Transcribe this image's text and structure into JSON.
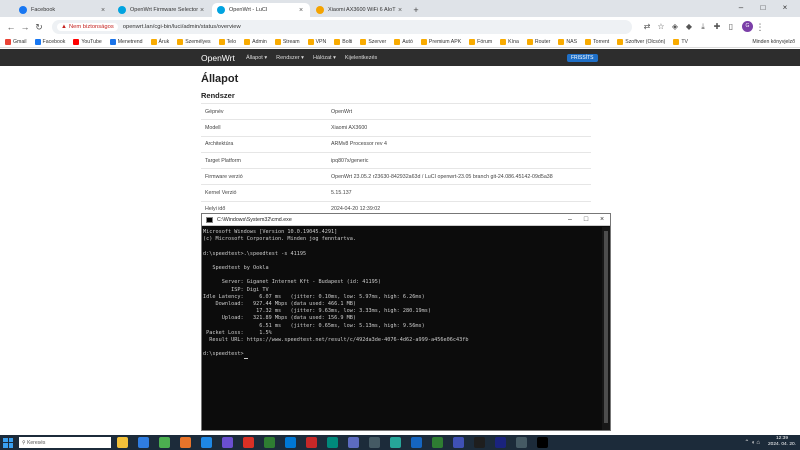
{
  "browser": {
    "tabs": [
      {
        "label": "Facebook",
        "color": "#1877f2",
        "active": false
      },
      {
        "label": "OpenWrt Firmware Selector",
        "color": "#00a3e0",
        "active": false
      },
      {
        "label": "OpenWrt - LuCI",
        "color": "#00a3e0",
        "active": true
      },
      {
        "label": "Xiaomi AX3600 WiFi 6 AIoT R",
        "color": "#f4a300",
        "active": false
      }
    ],
    "address": {
      "security_label": "Nem biztonságos",
      "url": "openwrt.lan/cgi-bin/luci/admin/status/overview"
    },
    "avatar_initial": "G",
    "bookmarks": [
      {
        "label": "Gmail",
        "color": "#ea4335"
      },
      {
        "label": "Facebook",
        "color": "#1877f2"
      },
      {
        "label": "YouTube",
        "color": "#ff0000"
      },
      {
        "label": "Menetrend",
        "color": "#1a73e8"
      },
      {
        "label": "Áruk",
        "color": "#f9ab00"
      },
      {
        "label": "Személyes",
        "color": "#f9ab00"
      },
      {
        "label": "Telo",
        "color": "#f9ab00"
      },
      {
        "label": "Admin",
        "color": "#f9ab00"
      },
      {
        "label": "Stream",
        "color": "#f9ab00"
      },
      {
        "label": "VPN",
        "color": "#f9ab00"
      },
      {
        "label": "Bolti",
        "color": "#f9ab00"
      },
      {
        "label": "Szerver",
        "color": "#f9ab00"
      },
      {
        "label": "Autó",
        "color": "#f9ab00"
      },
      {
        "label": "Premium APK",
        "color": "#f9ab00"
      },
      {
        "label": "Fórum",
        "color": "#f9ab00"
      },
      {
        "label": "Kína",
        "color": "#f9ab00"
      },
      {
        "label": "Router",
        "color": "#f9ab00"
      },
      {
        "label": "NAS",
        "color": "#f9ab00"
      },
      {
        "label": "Torrent",
        "color": "#f9ab00"
      },
      {
        "label": "Szoftver (Olcsón)",
        "color": "#f9ab00"
      },
      {
        "label": "TV",
        "color": "#f9ab00"
      }
    ],
    "bookmarks_other": "Minden könyvjelző"
  },
  "openwrt": {
    "brand": "OpenWrt",
    "nav": [
      "Állapot ▾",
      "Rendszer ▾",
      "Hálózat ▾",
      "Kijelentkezés"
    ],
    "changes_badge": "FRISSÍTS",
    "page_title": "Állapot",
    "section_title": "Rendszer",
    "system_rows": [
      {
        "key": "Gépnév",
        "value": "OpenWrt"
      },
      {
        "key": "Modell",
        "value": "Xiaomi AX3600"
      },
      {
        "key": "Architektúra",
        "value": "ARMv8 Processor rev 4"
      },
      {
        "key": "Target Platform",
        "value": "ipq807x/generic"
      },
      {
        "key": "Firmware verzió",
        "value": "OpenWrt 23.05.2 r23630-842932a63d / LuCI openwrt-23.05 branch git-24.086.45142-09d5a38"
      },
      {
        "key": "Kernel Verzió",
        "value": "5.15.137"
      },
      {
        "key": "Helyi idő",
        "value": "2024-04-20 12:39:02"
      }
    ]
  },
  "cmd": {
    "title": "C:\\Windows\\System32\\cmd.exe",
    "lines": [
      "Microsoft Windows [Version 10.0.19045.4291]",
      "(c) Microsoft Corporation. Minden jog fenntartva.",
      "",
      "d:\\speedtest>.\\speedtest -s 41195",
      "",
      "   Speedtest by Ookla",
      "",
      "      Server: Giganet Internet Kft - Budapest (id: 41195)",
      "         ISP: Digi TV",
      "Idle Latency:     6.07 ms   (jitter: 0.10ms, low: 5.97ms, high: 6.26ms)",
      "    Download:   927.44 Mbps (data used: 466.1 MB)",
      "                 17.32 ms   (jitter: 9.63ms, low: 3.33ms, high: 280.19ms)",
      "      Upload:   321.89 Mbps (data used: 156.9 MB)",
      "                  6.51 ms   (jitter: 0.65ms, low: 5.13ms, high: 9.56ms)",
      " Packet Loss:     1.5%",
      "  Result URL: https://www.speedtest.net/result/c/492da3de-4076-4d62-a999-a456e06c43fb",
      "",
      "d:\\speedtest>"
    ]
  },
  "taskbar": {
    "search_placeholder": "Keresés",
    "apps": [
      "#f3c13a",
      "#2f7de1",
      "#4caf50",
      "#e8742a",
      "#1e88e5",
      "#6a4fd0",
      "#d93025",
      "#2e7d32",
      "#0078d4",
      "#c62828",
      "#00897b",
      "#5c6bc0",
      "#455a64",
      "#26a69a",
      "#1565c0",
      "#2e7d32",
      "#3f51b5",
      "#1e1e1e",
      "#1a237e",
      "#455a64",
      "#000000"
    ],
    "time": "12:39",
    "date": "2024. 04. 20."
  }
}
